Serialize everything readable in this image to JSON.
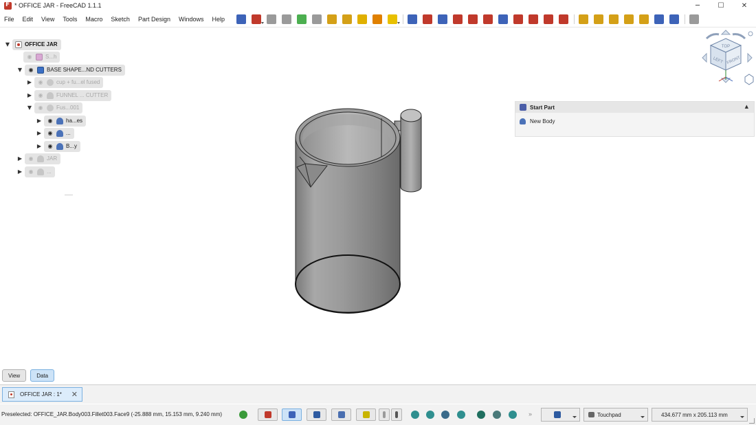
{
  "window": {
    "title": "* OFFICE JAR - FreeCAD 1.1.1",
    "minimize": "─",
    "maximize": "☐",
    "close": "✕"
  },
  "menu": [
    "File",
    "Edit",
    "View",
    "Tools",
    "Macro",
    "Sketch",
    "Part Design",
    "Windows",
    "Help"
  ],
  "toolbar_icons": [
    {
      "name": "body-icon",
      "color": "#3d63b8"
    },
    {
      "name": "part-icon",
      "color": "#c0392b"
    },
    {
      "name": "sketch-map-icon",
      "color": "#9a9a9a"
    },
    {
      "name": "sketch-validate-icon",
      "color": "#9a9a9a"
    },
    {
      "name": "shape-binder-icon",
      "color": "#4caf50"
    },
    {
      "name": "clone-icon",
      "color": "#9a9a9a"
    },
    {
      "name": "datum-point-icon",
      "color": "#d4a017"
    },
    {
      "name": "datum-line-icon",
      "color": "#d4a017"
    },
    {
      "name": "datum-plane-icon",
      "color": "#e0b000"
    },
    {
      "name": "local-cs-icon",
      "color": "#e08000"
    },
    {
      "name": "shape-binder-yellow-icon",
      "color": "#e8c000"
    },
    {
      "name": "pad-icon",
      "color": "#3d63b8"
    },
    {
      "name": "revolution-icon",
      "color": "#c0392b"
    },
    {
      "name": "additive-loft-icon",
      "color": "#3d63b8"
    },
    {
      "name": "additive-pipe-icon",
      "color": "#c0392b"
    },
    {
      "name": "additive-helix-icon",
      "color": "#c0392b"
    },
    {
      "name": "additive-primitive-icon",
      "color": "#c0392b"
    },
    {
      "name": "pocket-icon",
      "color": "#3d63b8"
    },
    {
      "name": "hole-icon",
      "color": "#c0392b"
    },
    {
      "name": "groove-icon",
      "color": "#c0392b"
    },
    {
      "name": "subtractive-loft-icon",
      "color": "#c0392b"
    },
    {
      "name": "subtractive-pipe-icon",
      "color": "#c0392b"
    },
    {
      "name": "mirrored-icon",
      "color": "#d4a017"
    },
    {
      "name": "linear-pattern-icon",
      "color": "#d4a017"
    },
    {
      "name": "polar-pattern-icon",
      "color": "#d4a017"
    },
    {
      "name": "multi-transform-icon",
      "color": "#d4a017"
    },
    {
      "name": "fillet-icon",
      "color": "#d4a017"
    },
    {
      "name": "chamfer-icon",
      "color": "#3d63b8"
    },
    {
      "name": "draft-icon",
      "color": "#3d63b8"
    },
    {
      "name": "thickness-icon",
      "color": "#9a9a9a"
    }
  ],
  "tree": {
    "root_label": "OFFICE JAR",
    "items": [
      {
        "label": "S...h"
      },
      {
        "label": "BASE SHAPE...ND CUTTERS"
      },
      {
        "label": "cup + fu...el fused"
      },
      {
        "label": "FUNNEL ... CUTTER"
      },
      {
        "label": "Fus...001"
      },
      {
        "label": "ha...es"
      },
      {
        "label": "..."
      },
      {
        "label": "B...y"
      },
      {
        "label": "JAR"
      },
      {
        "label": "..."
      }
    ]
  },
  "nav_cube": {
    "top": "TOP",
    "front": "FRONT",
    "left": "LEFT"
  },
  "task_panel": {
    "title": "Start Part",
    "item": "New Body",
    "collapse": "▲"
  },
  "view_tabs": [
    "View",
    "Data"
  ],
  "doc_tab": {
    "label": "OFFICE JAR : 1*",
    "close": "✕"
  },
  "status": {
    "text": "Preselected: OFFICE_JAR.Body003.Fillet003.Face9 (-25.888 mm, 15.153 mm, 9.240 mm)",
    "nav_style": "Touchpad",
    "dimensions": "434.677 mm x 205.113 mm",
    "more": "»"
  }
}
